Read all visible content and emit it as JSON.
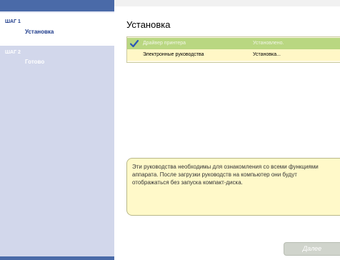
{
  "sidebar": {
    "steps": [
      {
        "title": "ШАГ 1",
        "name": "Установка"
      },
      {
        "title": "ШАГ 2",
        "name": "Готово"
      }
    ]
  },
  "main": {
    "title": "Установка",
    "items": [
      {
        "name": "Драйвер принтера",
        "status": "Установлено.",
        "done": true
      },
      {
        "name": "Электронные руководства",
        "status": "Установка...",
        "done": false
      }
    ],
    "info": "Эти руководства необходимы для ознакомления со всеми функциями аппарата. После загрузки руководств на компьютер они будут отображаться без запуска компакт-диска."
  },
  "buttons": {
    "next": "Далее"
  },
  "colors": {
    "accent": "#4a6aa8",
    "done_row": "#b9d781",
    "active_row": "#fff7c6"
  }
}
